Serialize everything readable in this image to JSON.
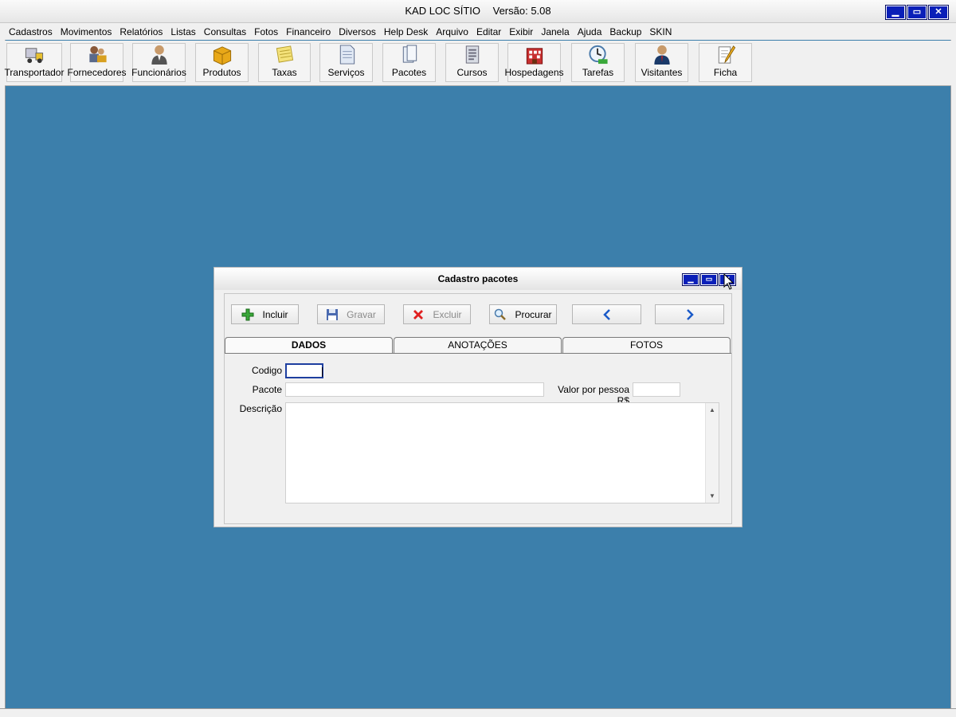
{
  "window": {
    "app_name": "KAD LOC SÍTIO",
    "version": "Versão: 5.08",
    "controls": [
      "minimize-icon",
      "maximize-icon",
      "close-icon"
    ]
  },
  "menu": {
    "items": [
      "Cadastros",
      "Movimentos",
      "Relatórios",
      "Listas",
      "Consultas",
      "Fotos",
      "Financeiro",
      "Diversos",
      "Help Desk",
      "Arquivo",
      "Editar",
      "Exibir",
      "Janela",
      "Ajuda",
      "Backup",
      "SKIN"
    ]
  },
  "toolbar": {
    "buttons": [
      {
        "label": "Transportador",
        "icon": "truck-icon"
      },
      {
        "label": "Fornecedores",
        "icon": "suppliers-icon"
      },
      {
        "label": "Funcionários",
        "icon": "employee-icon"
      },
      {
        "label": "Produtos",
        "icon": "box-icon"
      },
      {
        "label": "Taxas",
        "icon": "notepad-icon"
      },
      {
        "label": "Serviços",
        "icon": "document-icon"
      },
      {
        "label": "Pacotes",
        "icon": "pages-icon"
      },
      {
        "label": "Cursos",
        "icon": "list-icon"
      },
      {
        "label": "Hospedagens",
        "icon": "hotel-icon"
      },
      {
        "label": "Tarefas",
        "icon": "clock-icon"
      },
      {
        "label": "Visitantes",
        "icon": "visitor-icon"
      },
      {
        "label": "Ficha",
        "icon": "form-icon"
      }
    ]
  },
  "dialog": {
    "title": "Cadastro pacotes",
    "actions": {
      "incluir": "Incluir",
      "gravar": "Gravar",
      "excluir": "Excluir",
      "procurar": "Procurar"
    },
    "tabs": [
      "DADOS",
      "ANOTAÇÕES",
      "FOTOS"
    ],
    "active_tab": "DADOS",
    "fields": {
      "codigo_label": "Codigo",
      "codigo_value": "",
      "pacote_label": "Pacote",
      "pacote_value": "",
      "valor_label": "Valor por pessoa R$",
      "valor_value": "",
      "descricao_label": "Descrição",
      "descricao_value": ""
    }
  },
  "colors": {
    "desktop": "#3c7fab",
    "window_button": "#0a1fb8"
  }
}
